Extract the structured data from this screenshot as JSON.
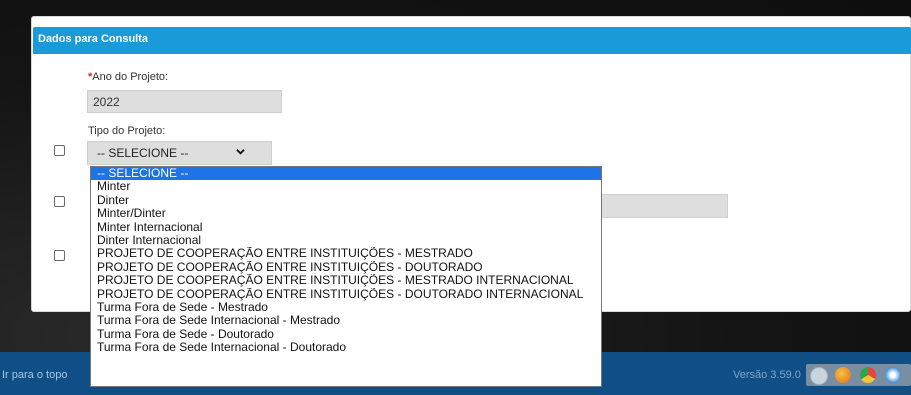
{
  "panel": {
    "title": "Dados para Consulta"
  },
  "form": {
    "ano_label": "Ano do Projeto:",
    "ano_required_mark": "*",
    "ano_value": "2022",
    "tipo_label": "Tipo do Projeto:",
    "tipo_selected": "-- SELECIONE --"
  },
  "dropdown": {
    "options": [
      "-- SELECIONE --",
      "Minter",
      "Dinter",
      "Minter/Dinter",
      "Minter Internacional",
      "Dinter Internacional",
      "PROJETO DE COOPERAÇÃO ENTRE INSTITUIÇÕES - MESTRADO",
      "PROJETO DE COOPERAÇÃO ENTRE INSTITUIÇÕES - DOUTORADO",
      "PROJETO DE COOPERAÇÃO ENTRE INSTITUIÇÕES - MESTRADO INTERNACIONAL",
      "PROJETO DE COOPERAÇÃO ENTRE INSTITUIÇÕES - DOUTORADO INTERNACIONAL",
      "Turma Fora de Sede - Mestrado",
      "Turma Fora de Sede Internacional - Mestrado",
      "Turma Fora de Sede - Doutorado",
      "Turma Fora de Sede Internacional - Doutorado"
    ],
    "selected_index": 0
  },
  "footer": {
    "back_to_top": "Ir para o topo",
    "version": "Versão 3.59.0"
  },
  "browser_icons": [
    "ie-icon",
    "firefox-icon",
    "chrome-icon",
    "safari-icon"
  ],
  "colors": {
    "header": "#1a9ad8",
    "footer": "#0f4f85",
    "selected_option": "#1e73e8",
    "required": "#dd2222"
  }
}
